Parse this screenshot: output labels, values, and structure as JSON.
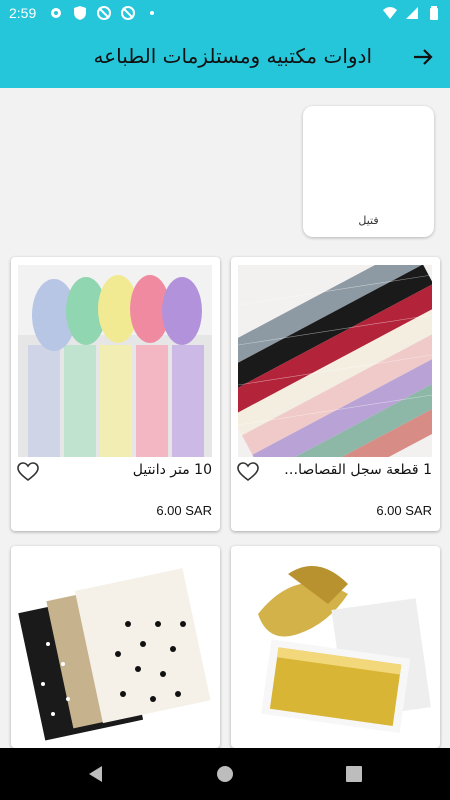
{
  "status_bar": {
    "time": "2:59",
    "icons_left": [
      "settings-icon",
      "shield-icon",
      "no-sync-icon",
      "no-sync-icon",
      "dot-icon"
    ],
    "icons_right": [
      "wifi-icon",
      "signal-icon",
      "battery-icon"
    ]
  },
  "app_bar": {
    "title": "ادوات مكتبيه ومستلزمات الطباعه",
    "back_icon": "arrow-right-icon",
    "background": "#26c6da"
  },
  "categories": [
    {
      "label": "فتيل"
    }
  ],
  "products": [
    {
      "name": "1 قطعة سجل القصاصات ...",
      "price": "6.00 SAR",
      "image": "colored-mesh-rolls"
    },
    {
      "name": "10 متر دانتيل",
      "price": "6.00 SAR",
      "image": "lace-ribbon-rolls"
    },
    {
      "name": "",
      "price": "",
      "image": "gold-leaf-sheets"
    },
    {
      "name": "",
      "price": "",
      "image": "polka-dot-paper"
    }
  ],
  "nav_bar": {
    "buttons": [
      "back-triangle-icon",
      "home-circle-icon",
      "recents-square-icon"
    ]
  }
}
